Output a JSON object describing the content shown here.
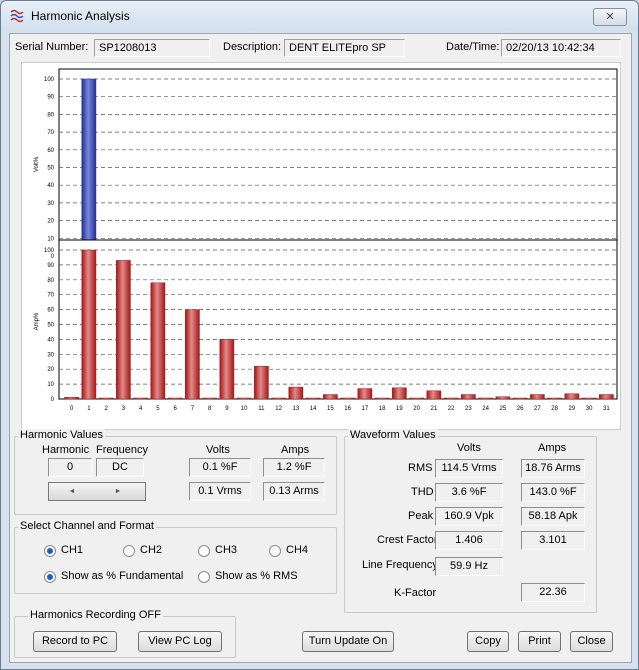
{
  "window": {
    "title": "Harmonic Analysis",
    "close_glyph": "✕"
  },
  "header": {
    "serial_label": "Serial Number:",
    "serial_value": "SP1208013",
    "description_label": "Description:",
    "description_value": "DENT ELITEpro SP",
    "datetime_label": "Date/Time:",
    "datetime_value": "02/20/13 10:42:34"
  },
  "chart_data": [
    {
      "type": "bar",
      "ylabel": "Volt%",
      "ylim": [
        0,
        100
      ],
      "yticks": [
        0,
        10,
        20,
        30,
        40,
        50,
        60,
        70,
        80,
        90,
        100
      ],
      "color": "#1f2f99",
      "grid": true,
      "categories": [
        0,
        1,
        2,
        3,
        4,
        5,
        6,
        7,
        8,
        9,
        10,
        11,
        12,
        13,
        14,
        15,
        16,
        17,
        18,
        19,
        20,
        21,
        22,
        23,
        24,
        25,
        26,
        27,
        28,
        29,
        30,
        31
      ],
      "values": [
        0.4,
        100,
        0.3,
        2.4,
        0.3,
        3,
        0.3,
        1.4,
        0.3,
        0.6,
        0.2,
        0.5,
        0.2,
        0.5,
        0.2,
        0.3,
        0.2,
        0.3,
        0.2,
        0.3,
        0.2,
        0.3,
        0.2,
        0.3,
        0.2,
        0.3,
        0.2,
        0.3,
        0.2,
        0.3,
        0.2,
        0.3
      ]
    },
    {
      "type": "bar",
      "ylabel": "Amp%",
      "ylim": [
        0,
        100
      ],
      "yticks": [
        0,
        10,
        20,
        30,
        40,
        50,
        60,
        70,
        80,
        90,
        100
      ],
      "color": "#a51616",
      "grid": true,
      "xticks": [
        "0",
        "1",
        "2",
        "3",
        "4",
        "5",
        "6",
        "7",
        "8",
        "9",
        "10",
        "11",
        "12",
        "13",
        "14",
        "15",
        "16",
        "17",
        "18",
        "19",
        "20",
        "21",
        "22",
        "23",
        "24",
        "25",
        "26",
        "27",
        "28",
        "29",
        "30",
        "31"
      ],
      "categories": [
        0,
        1,
        2,
        3,
        4,
        5,
        6,
        7,
        8,
        9,
        10,
        11,
        12,
        13,
        14,
        15,
        16,
        17,
        18,
        19,
        20,
        21,
        22,
        23,
        24,
        25,
        26,
        27,
        28,
        29,
        30,
        31
      ],
      "values": [
        1.2,
        100,
        0.5,
        93,
        0.5,
        78,
        0.4,
        60,
        0.4,
        40,
        0.3,
        22,
        0.3,
        8,
        0.3,
        3,
        0.3,
        7,
        0.3,
        7.5,
        0.3,
        5.5,
        0.3,
        3,
        0.3,
        1.5,
        0.3,
        3,
        0.3,
        3.5,
        0.3,
        3
      ]
    }
  ],
  "harmonic_values": {
    "title": "Harmonic Values",
    "harmonic_label": "Harmonic",
    "frequency_label": "Frequency",
    "harmonic": "0",
    "frequency": "DC",
    "volts_label": "Volts",
    "amps_label": "Amps",
    "volts_pct": "0.1 %F",
    "amps_pct": "1.2 %F",
    "volts_rms": "0.1 Vrms",
    "amps_rms": "0.13 Arms",
    "prev": "◄",
    "next": "►"
  },
  "channel": {
    "title": "Select Channel and Format",
    "ch1": "CH1",
    "ch2": "CH2",
    "ch3": "CH3",
    "ch4": "CH4",
    "fmt_fund": "Show as % Fundamental",
    "fmt_rms": "Show as % RMS"
  },
  "waveform": {
    "title": "Waveform Values",
    "volts_label": "Volts",
    "amps_label": "Amps",
    "rms_label": "RMS",
    "rms_v": "114.5 Vrms",
    "rms_a": "18.76 Arms",
    "thd_label": "THD",
    "thd_v": "3.6 %F",
    "thd_a": "143.0 %F",
    "peak_label": "Peak",
    "peak_v": "160.9 Vpk",
    "peak_a": "58.18 Apk",
    "crest_label": "Crest Factor",
    "crest_v": "1.406",
    "crest_a": "3.101",
    "linefreq_label": "Line Frequency",
    "linefreq_v": "59.9 Hz",
    "kfactor_label": "K-Factor",
    "kfactor_a": "22.36"
  },
  "recording": {
    "title": "Harmonics Recording OFF",
    "record": "Record to PC",
    "view_log": "View PC Log"
  },
  "footer": {
    "turn_update": "Turn Update On",
    "copy": "Copy",
    "print": "Print",
    "close": "Close"
  }
}
